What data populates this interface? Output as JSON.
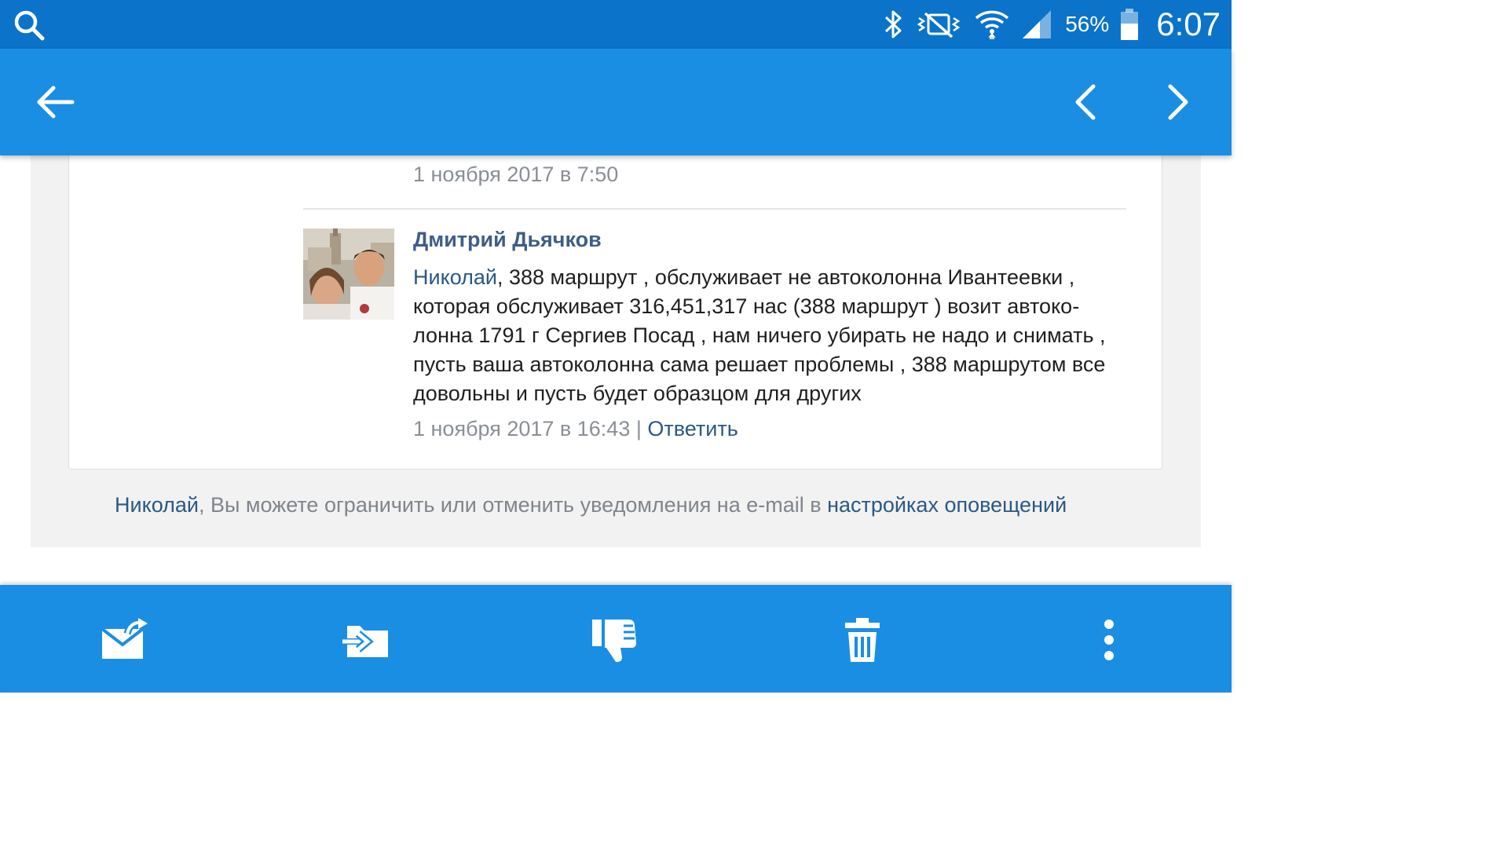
{
  "status_bar": {
    "battery_percent": "56%",
    "time": "6:07",
    "icons": [
      "search-icon",
      "bluetooth-icon",
      "vibrate-mute-icon",
      "wifi-icon",
      "signal-icon",
      "battery-icon"
    ]
  },
  "app_bar": {
    "icons": [
      "back-arrow-icon",
      "chevron-left-icon",
      "chevron-right-icon"
    ]
  },
  "thread": {
    "previous_comment_date": "1 ноября 2017 в 7:50",
    "comment": {
      "author": "Дмитрий Дьячков",
      "mention": "Николай",
      "text": ", 388 маршрут , обслуживает не автоколонна Ивантеевки , которая обслуживает 316,451,317 нас (388 маршрут ) возит автоко-лонна 1791 г Сергиев Посад , нам ничего убирать не надо и снимать , пусть ваша автоколонна сама решает проблемы , 388 маршрутом все довольны и пусть будет образцом для других",
      "date": "1 ноября 2017 в 16:43",
      "separator": "|",
      "reply_label": "Ответить"
    }
  },
  "notice": {
    "name_link": "Николай",
    "text": ", Вы можете ограничить или отменить уведомления на e-mail в ",
    "settings_link": "настройках оповещений"
  },
  "bottom_bar": {
    "icons": [
      "mark-unread-icon",
      "move-to-folder-icon",
      "spam-thumbs-down-icon",
      "delete-trash-icon",
      "more-vertical-icon"
    ]
  },
  "colors": {
    "status_bar": "#0b73c9",
    "app_bar": "#1a8ee3",
    "link": "#2a5885",
    "author": "#3e5e85"
  }
}
